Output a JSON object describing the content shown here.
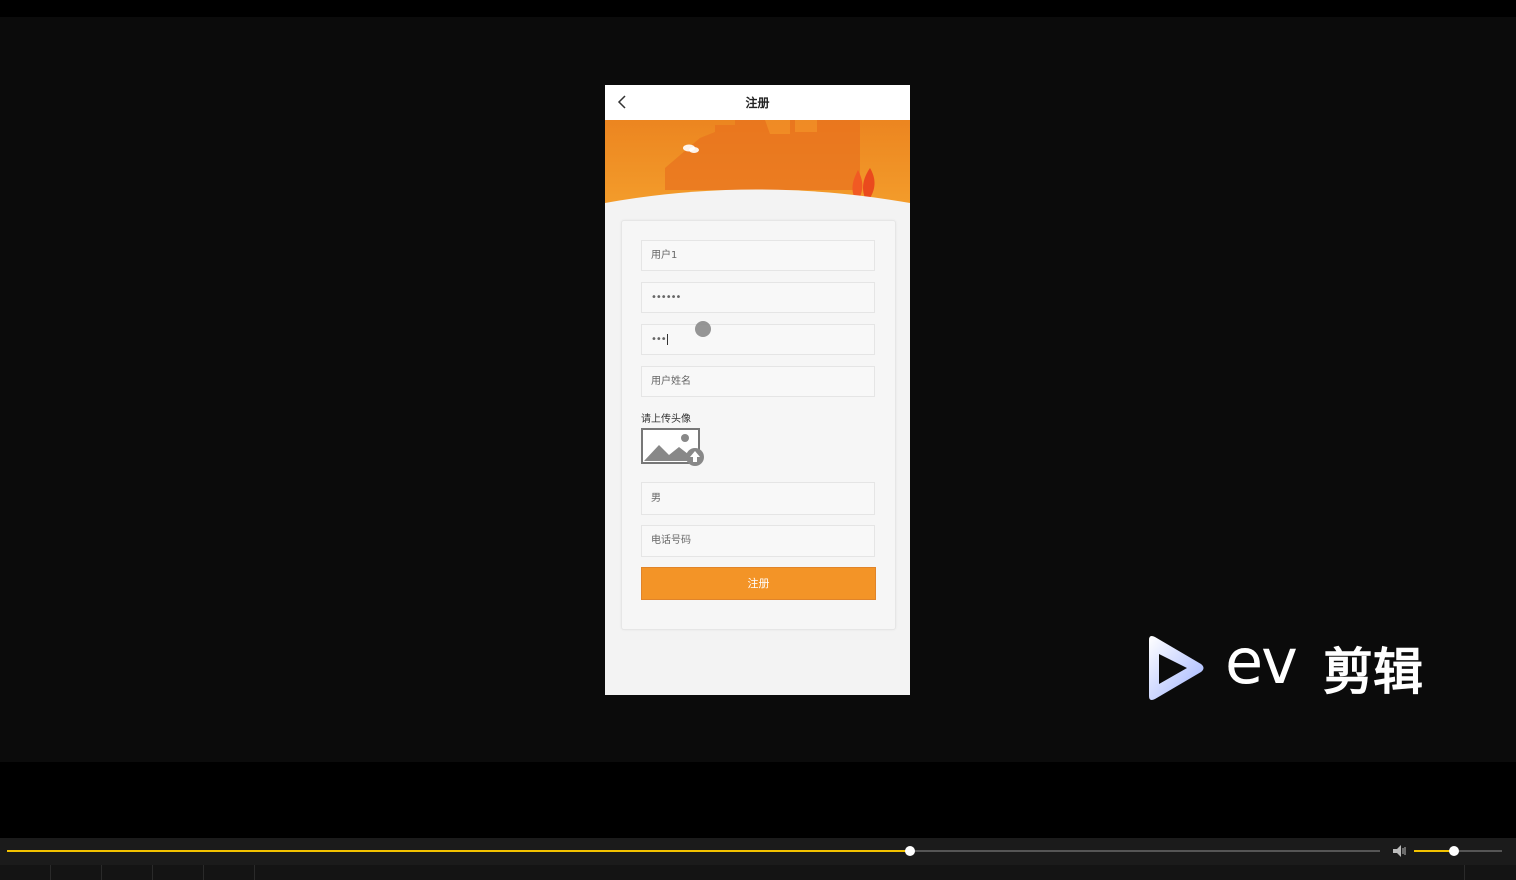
{
  "header": {
    "title": "注册"
  },
  "form": {
    "username": "用户1",
    "password": "••••••",
    "confirm_password": "•••",
    "real_name_placeholder": "用户姓名",
    "upload_label": "请上传头像",
    "gender": "男",
    "phone_placeholder": "电话号码",
    "submit_label": "注册"
  },
  "watermark": {
    "ev": "ev",
    "text": "剪辑"
  },
  "player": {
    "progress": 0.658,
    "volume": 0.45
  },
  "colors": {
    "accent": "#f39427",
    "progress": "#f2c200",
    "banner_top": "#e9761d",
    "banner_bottom": "#f6a12c"
  }
}
